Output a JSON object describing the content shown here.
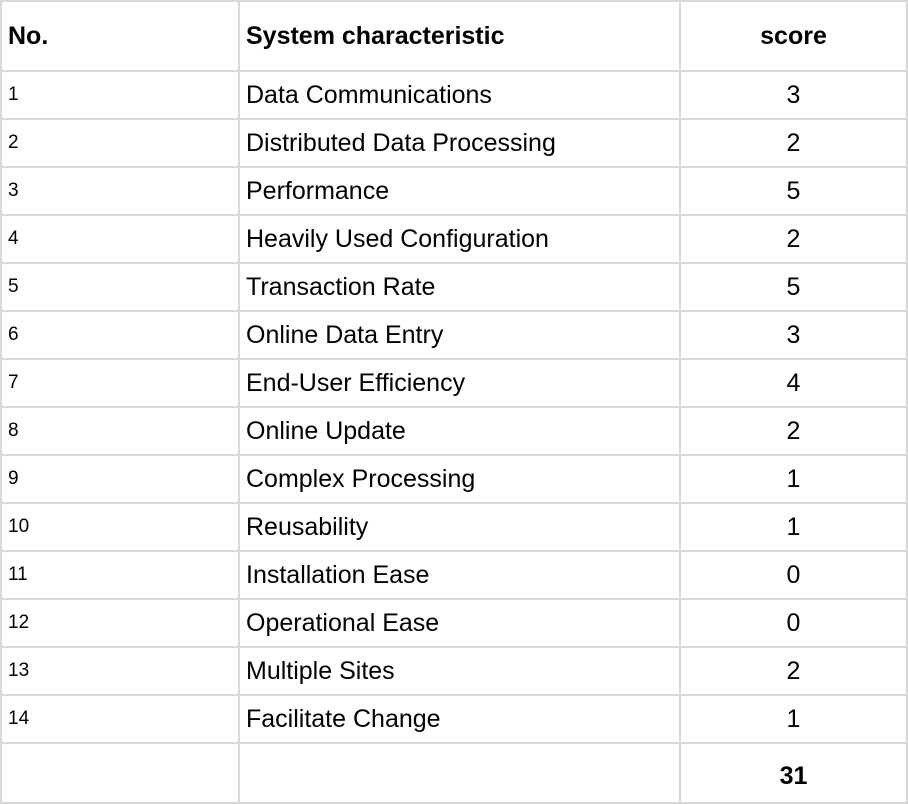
{
  "table": {
    "headers": {
      "no": "No.",
      "characteristic": "System characteristic",
      "score": "score"
    },
    "rows": [
      {
        "no": "1",
        "characteristic": "Data Communications",
        "score": "3"
      },
      {
        "no": "2",
        "characteristic": "Distributed Data Processing",
        "score": "2"
      },
      {
        "no": "3",
        "characteristic": "Performance",
        "score": "5"
      },
      {
        "no": "4",
        "characteristic": "Heavily Used Configuration",
        "score": "2"
      },
      {
        "no": "5",
        "characteristic": "Transaction Rate",
        "score": "5"
      },
      {
        "no": "6",
        "characteristic": "Online Data Entry",
        "score": "3"
      },
      {
        "no": "7",
        "characteristic": "End-User Efficiency",
        "score": "4"
      },
      {
        "no": "8",
        "characteristic": "Online Update",
        "score": "2"
      },
      {
        "no": "9",
        "characteristic": "Complex Processing",
        "score": "1"
      },
      {
        "no": "10",
        "characteristic": "Reusability",
        "score": "1"
      },
      {
        "no": "11",
        "characteristic": "Installation Ease",
        "score": "0"
      },
      {
        "no": "12",
        "characteristic": "Operational Ease",
        "score": "0"
      },
      {
        "no": "13",
        "characteristic": "Multiple Sites",
        "score": "2"
      },
      {
        "no": "14",
        "characteristic": "Facilitate Change",
        "score": "1"
      }
    ],
    "total": {
      "no": "",
      "characteristic": "",
      "score": "31"
    }
  },
  "colors": {
    "grid_line": "#d8d8d8",
    "text": "#000000",
    "background": "#ffffff"
  }
}
